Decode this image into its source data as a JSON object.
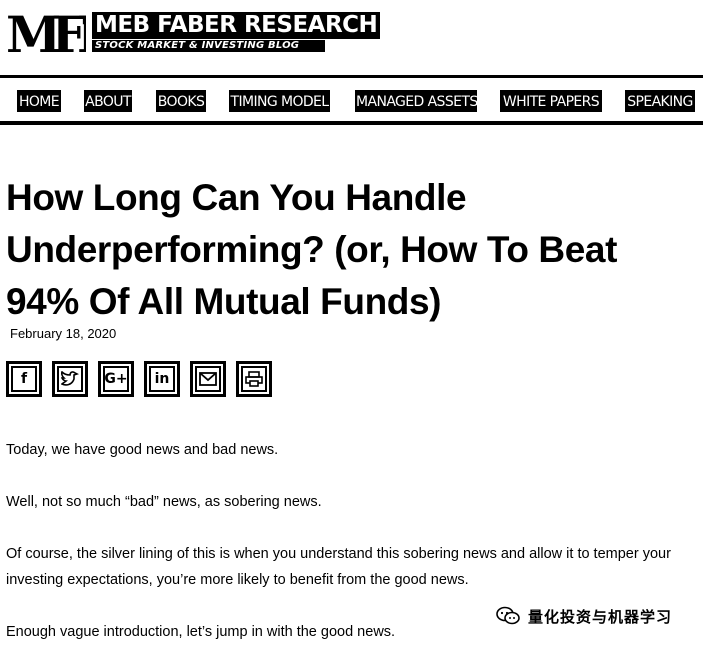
{
  "header": {
    "logo_letters": "MFR",
    "brand_name": "MEB FABER RESEARCH",
    "tagline": "STOCK MARKET & INVESTING BLOG"
  },
  "nav": {
    "items": [
      {
        "label": "HOME"
      },
      {
        "label": "ABOUT"
      },
      {
        "label": "BOOKS"
      },
      {
        "label": "TIMING MODEL"
      },
      {
        "label": "MANAGED ASSETS"
      },
      {
        "label": "WHITE PAPERS"
      },
      {
        "label": "SPEAKING"
      }
    ]
  },
  "article": {
    "title": "How Long Can You Handle Underperforming? (or, How To Beat 94% Of All Mutual Funds)",
    "date": "February 18, 2020",
    "share_icons": [
      "facebook-icon",
      "twitter-icon",
      "google-plus-icon",
      "linkedin-icon",
      "email-icon",
      "print-icon"
    ],
    "share_glyphs": {
      "facebook": "f",
      "google": "G+",
      "linkedin": "in"
    },
    "paragraphs": [
      "Today, we have good news and bad news.",
      "Well, not so much “bad” news, as sobering news.",
      "Of course, the silver lining of this is when you understand this sobering news and allow it to temper your investing expectations, you’re more likely to benefit from the good news.",
      "Enough vague introduction, let’s jump in with the good news."
    ]
  },
  "watermark": {
    "text": "量化投资与机器学习",
    "icon": "wechat-icon"
  },
  "colors": {
    "foreground": "#000000",
    "background": "#ffffff"
  }
}
